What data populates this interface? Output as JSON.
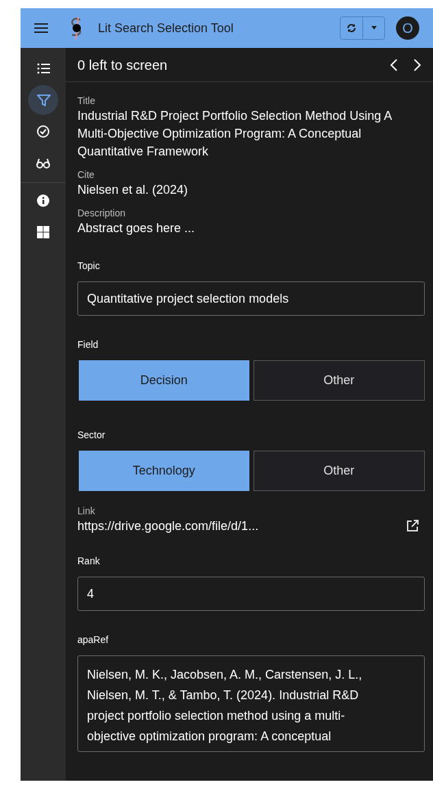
{
  "app_bar": {
    "title": "Lit Search Selection Tool",
    "avatar": "O"
  },
  "sidebar": {
    "items": [
      {
        "kind": "list",
        "selected": false
      },
      {
        "kind": "filter",
        "selected": true
      },
      {
        "kind": "check",
        "selected": false
      },
      {
        "kind": "glasses",
        "selected": false
      },
      {
        "kind": "info",
        "selected": false
      },
      {
        "kind": "grid",
        "selected": false
      }
    ]
  },
  "header": {
    "title": "0 left to screen"
  },
  "fields": [
    {
      "kind": "text",
      "label": "Title",
      "value": "Industrial R&D Project Portfolio Selection Method Using A Multi-Objective Optimization Program: A Conceptual Quantitative Framework"
    },
    {
      "kind": "text",
      "label": "Cite",
      "value": "Nielsen et al. (2024)"
    },
    {
      "kind": "text",
      "label": "Description",
      "value": "Abstract goes here ..."
    },
    {
      "kind": "input",
      "label": "Topic",
      "value": "Quantitative project selection models"
    },
    {
      "kind": "toggle",
      "label": "Field",
      "options": [
        {
          "label": "Decision",
          "selected": true
        },
        {
          "label": "Other",
          "selected": false
        }
      ]
    },
    {
      "kind": "toggle",
      "label": "Sector",
      "options": [
        {
          "label": "Technology",
          "selected": true
        },
        {
          "label": "Other",
          "selected": false
        }
      ]
    },
    {
      "kind": "link",
      "label": "Link",
      "value": "https://drive.google.com/file/d/1..."
    },
    {
      "kind": "input",
      "label": "Rank",
      "value": "4"
    },
    {
      "kind": "textarea",
      "label": "apaRef",
      "value": "Nielsen, M. K., Jacobsen, A. M., Carstensen, J. L., Nielsen, M. T., & Tambo, T. (2024). Industrial R&D project portfolio selection method using a multi-objective optimization program: A conceptual"
    }
  ]
}
